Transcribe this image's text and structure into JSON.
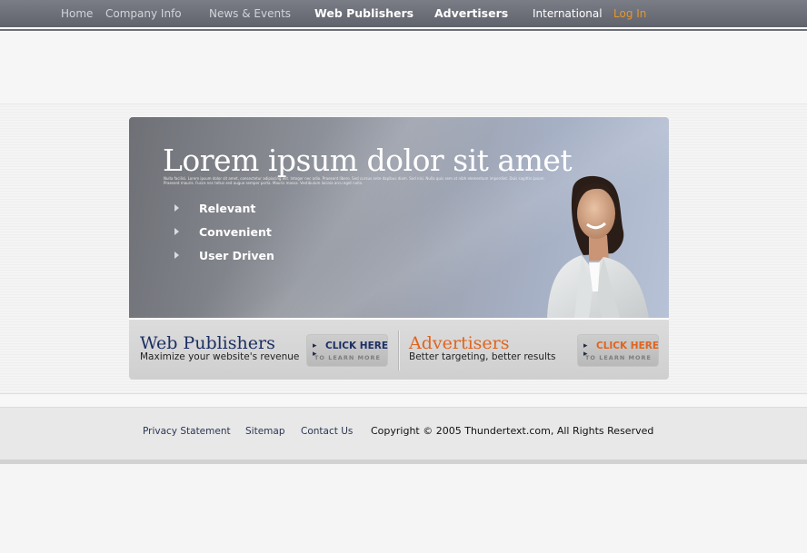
{
  "nav": {
    "items": [
      {
        "label": "Home"
      },
      {
        "label": "Company Info"
      },
      {
        "label": "News & Events"
      },
      {
        "label": "Web Publishers"
      },
      {
        "label": "Advertisers"
      },
      {
        "label": "International"
      },
      {
        "label": "Log In"
      }
    ]
  },
  "hero": {
    "title": "Lorem ipsum dolor sit amet",
    "fine_print": "Nulla facilisi. Lorem ipsum dolor sit amet, consectetur adipiscing elit. Integer nec odio. Praesent libero. Sed cursus ante dapibus diam. Sed nisi. Nulla quis sem at nibh elementum imperdiet. Duis sagittis ipsum. Praesent mauris. Fusce nec tellus sed augue semper porta. Mauris massa. Vestibulum lacinia arcu eget nulla.",
    "bullets": [
      "Relevant",
      "Convenient",
      "User Driven"
    ]
  },
  "publishers": {
    "title": "Web Publishers",
    "subtitle": "Maximize your website's revenue",
    "cta_main": "CLICK HERE",
    "cta_sub": "TO LEARN MORE"
  },
  "advertisers": {
    "title": "Advertisers",
    "subtitle": "Better targeting, better results",
    "cta_main": "CLICK HERE",
    "cta_sub": "TO LEARN MORE"
  },
  "footer": {
    "links": [
      "Privacy Statement",
      "Sitemap",
      "Contact Us"
    ],
    "copyright": "Copyright © 2005 Thundertext.com, All Rights Reserved"
  },
  "colors": {
    "nav_bg": "#6a6d76",
    "login": "#e8962a",
    "publisher_blue": "#1c2f63",
    "advertiser_orange": "#e0641e"
  }
}
